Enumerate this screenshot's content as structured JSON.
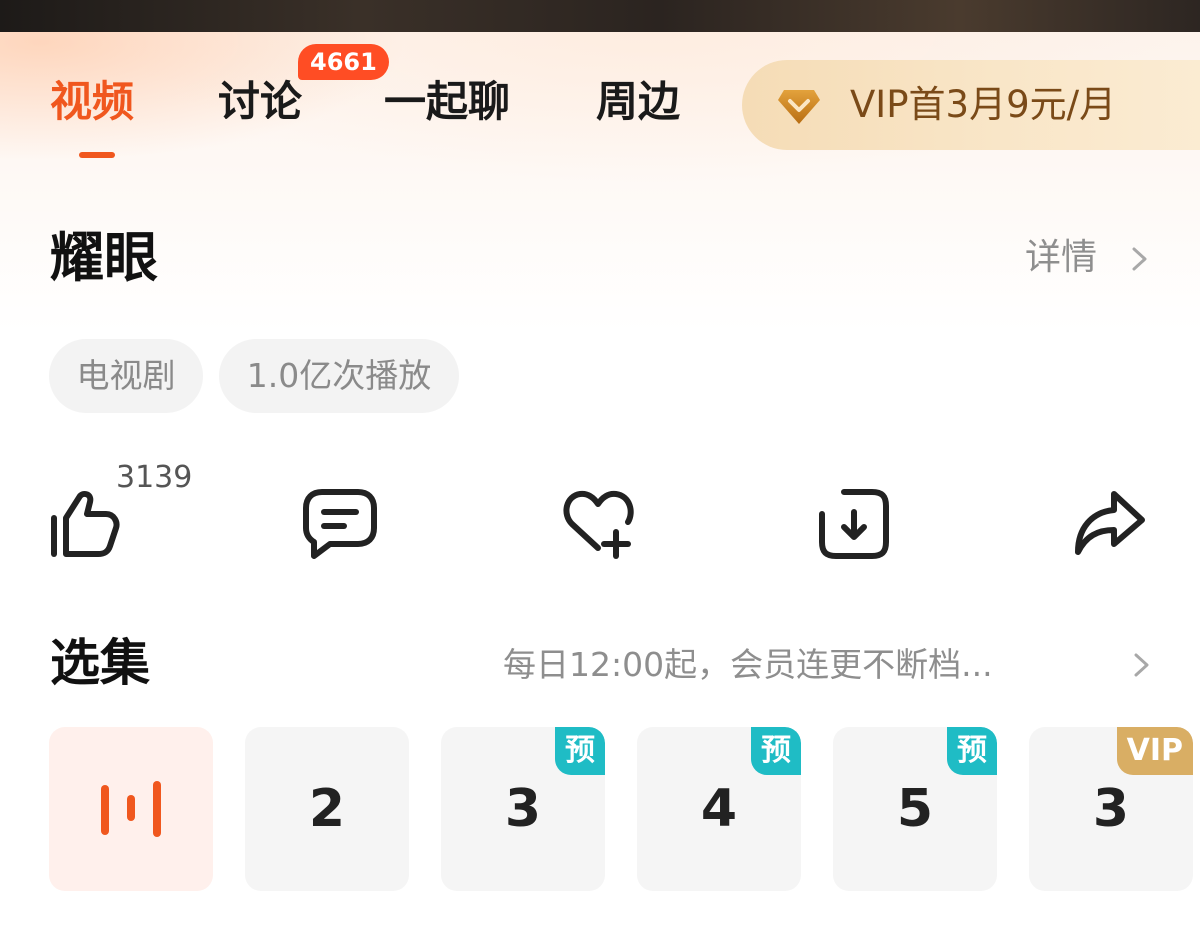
{
  "tabs": [
    {
      "label": "视频",
      "active": true
    },
    {
      "label": "讨论",
      "badge": "4661"
    },
    {
      "label": "一起聊"
    },
    {
      "label": "周边"
    }
  ],
  "vip_banner": {
    "text": "VIP首3月9元/月",
    "icon": "diamond-icon"
  },
  "show": {
    "title": "耀眼",
    "detail_label": "详情",
    "tags": [
      "电视剧",
      "1.0亿次播放"
    ]
  },
  "actions": {
    "like_count": "3139",
    "icons": [
      "thumbs-up-icon",
      "comment-icon",
      "favorite-add-icon",
      "download-icon",
      "share-icon"
    ]
  },
  "episodes": {
    "title": "选集",
    "schedule": "每日12:00起，会员连更不断档...",
    "items": [
      {
        "label": "",
        "state": "playing"
      },
      {
        "label": "2",
        "badge": ""
      },
      {
        "label": "3",
        "badge": "预"
      },
      {
        "label": "4",
        "badge": "预"
      },
      {
        "label": "5",
        "badge": "预"
      },
      {
        "label": "3",
        "badge": "VIP"
      }
    ]
  },
  "colors": {
    "accent": "#f0571e",
    "badge_red": "#ff4d24",
    "pre_badge": "#1fbcc5",
    "vip_badge": "#d9ae64",
    "vip_text": "#7a4a18"
  }
}
